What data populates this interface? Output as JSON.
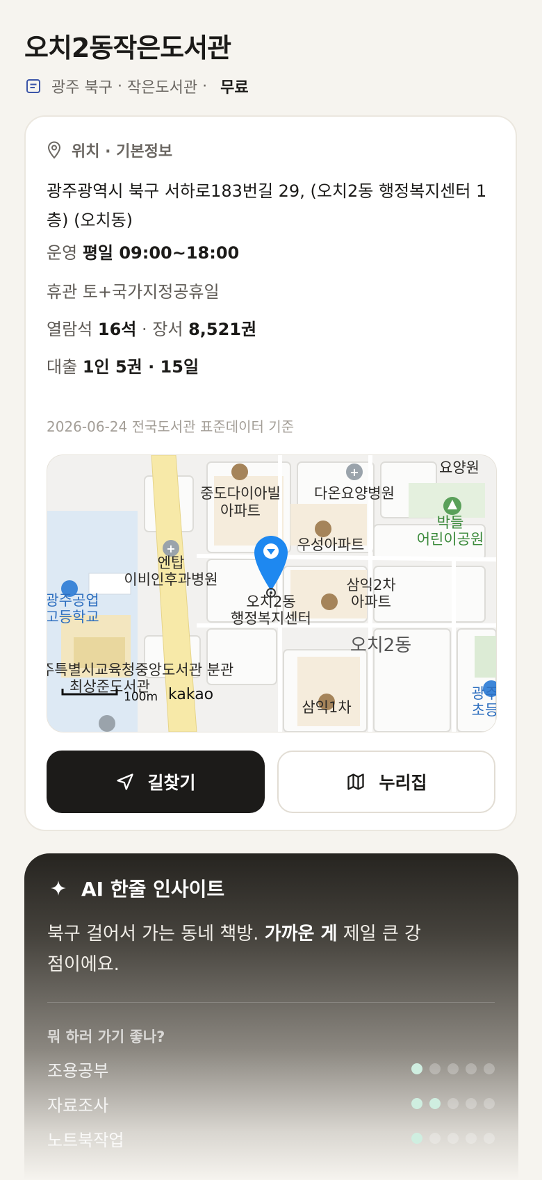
{
  "header": {
    "title": "오치2동작은도서관",
    "meta_region": "광주 북구",
    "meta_sep": " · ",
    "meta_type": "작은도서관",
    "meta_sep2": " · ",
    "meta_fee": "무료"
  },
  "info": {
    "section_label": "위치 · 기본정보",
    "address": "광주광역시 북구 서하로183번길 29, (오치2동 행정복지센터 1층) (오치동)",
    "hours_label": "운영",
    "hours_value": "평일 09:00~18:00",
    "closed_label": "휴관",
    "closed_value": "토+국가지정공휴일",
    "seats_label": "열람석",
    "seats_value": "16석",
    "sep": " · ",
    "books_label": "장서",
    "books_value": "8,521권",
    "loan_label": "대출",
    "loan_value": "1인 5권 · 15일",
    "data_basis": "2026-06-24 전국도서관 표준데이터 기준"
  },
  "map": {
    "labels": {
      "jungdo": "중도다이아빌",
      "jungdo2": "아파트",
      "daon": "다온요양병원",
      "yoyang": "요양원",
      "park1": "박들",
      "park2": "어린이공원",
      "woosung": "우성아파트",
      "entap1": "엔탑",
      "entap2": "이비인후과병원",
      "school1": "광주공업",
      "school2": "고등학교",
      "samik1": "삼익2차",
      "samik2": "아파트",
      "center1": "오치2동",
      "center2": "행정복지센터",
      "dong": "오치2동",
      "lib1": "광주특별시교육청중앙도서관 분관",
      "lib2": "최상준도서관",
      "samik3": "삼익1차",
      "gwangju1": "광주",
      "gwangju2": "초등",
      "scale": "100m",
      "brand": "kakao"
    },
    "colors": {
      "pin": "#1e88f0",
      "road_main": "#f7e9a8"
    }
  },
  "actions": {
    "directions": "길찾기",
    "website": "누리집"
  },
  "ai": {
    "title": "AI 한줄 인사이트",
    "insight_pre": "북구 걸어서 가는 동네 책방. ",
    "insight_bold": "가까운 게",
    "insight_post": " 제일 큰 강점이에요.",
    "question": "뭐 하러 가기 좋나?",
    "ratings": [
      {
        "label": "조용공부",
        "score": 1,
        "max": 5
      },
      {
        "label": "자료조사",
        "score": 2,
        "max": 5
      },
      {
        "label": "노트북작업",
        "score": 1,
        "max": 5
      }
    ]
  },
  "theme": {
    "accent": "#1c1b19",
    "dot_on": "#cfeee0"
  }
}
